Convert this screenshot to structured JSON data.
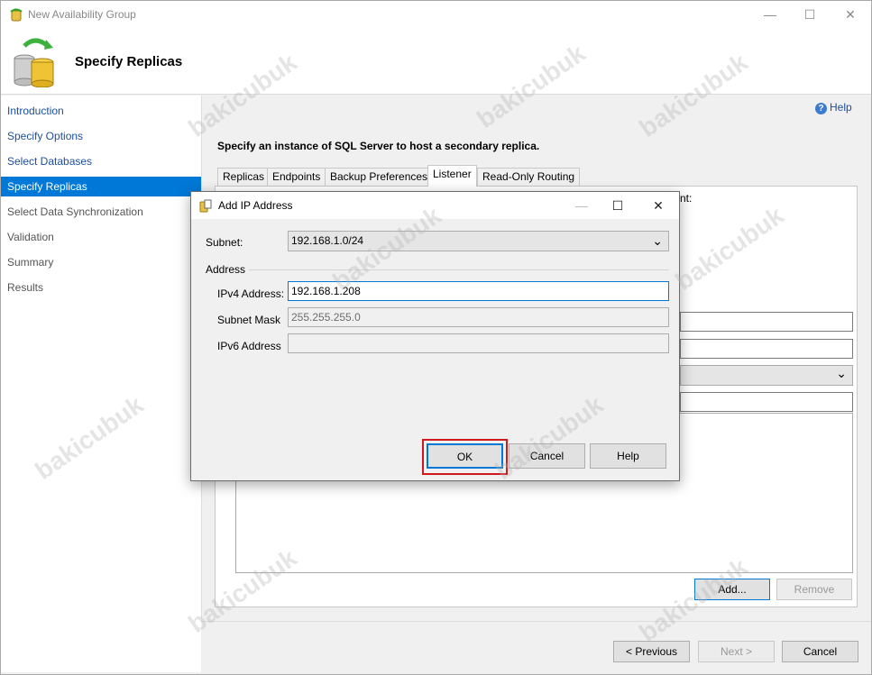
{
  "window": {
    "title": "New Availability Group",
    "page_title": "Specify Replicas",
    "minimize_glyph": "—",
    "maximize_glyph": "☐",
    "close_glyph": "✕"
  },
  "sidebar": {
    "items": [
      {
        "label": "Introduction"
      },
      {
        "label": "Specify Options"
      },
      {
        "label": "Select Databases"
      },
      {
        "label": "Specify Replicas"
      },
      {
        "label": "Select Data Synchronization"
      },
      {
        "label": "Validation"
      },
      {
        "label": "Summary"
      },
      {
        "label": "Results"
      }
    ]
  },
  "content": {
    "help_label": "Help",
    "help_icon_glyph": "?",
    "instruction": "Specify an instance of SQL Server to host a secondary replica.",
    "tabs": [
      {
        "label": "Replicas"
      },
      {
        "label": "Endpoints"
      },
      {
        "label": "Backup Preferences"
      },
      {
        "label": "Listener"
      },
      {
        "label": "Read-Only Routing"
      }
    ],
    "partial_text": "nt:",
    "dropdown_chevron": "⌄",
    "add_button": "Add...",
    "remove_button": "Remove"
  },
  "footer": {
    "previous_button": "< Previous",
    "next_button": "Next >",
    "cancel_button": "Cancel"
  },
  "dialog": {
    "title": "Add IP Address",
    "subnet_label": "Subnet:",
    "subnet_value": "192.168.1.0/24",
    "address_group_label": "Address",
    "ipv4_label": "IPv4 Address:",
    "ipv4_value": "192.168.1.208",
    "subnet_mask_label": "Subnet Mask",
    "subnet_mask_value": "255.255.255.0",
    "ipv6_label": "IPv6 Address",
    "ipv6_value": "",
    "ok_button": "OK",
    "cancel_button": "Cancel",
    "help_button": "Help"
  },
  "watermark_text": "bakicubuk",
  "colors": {
    "accent": "#0078d7",
    "link": "#1e4e9c",
    "highlight": "#d0181f"
  }
}
